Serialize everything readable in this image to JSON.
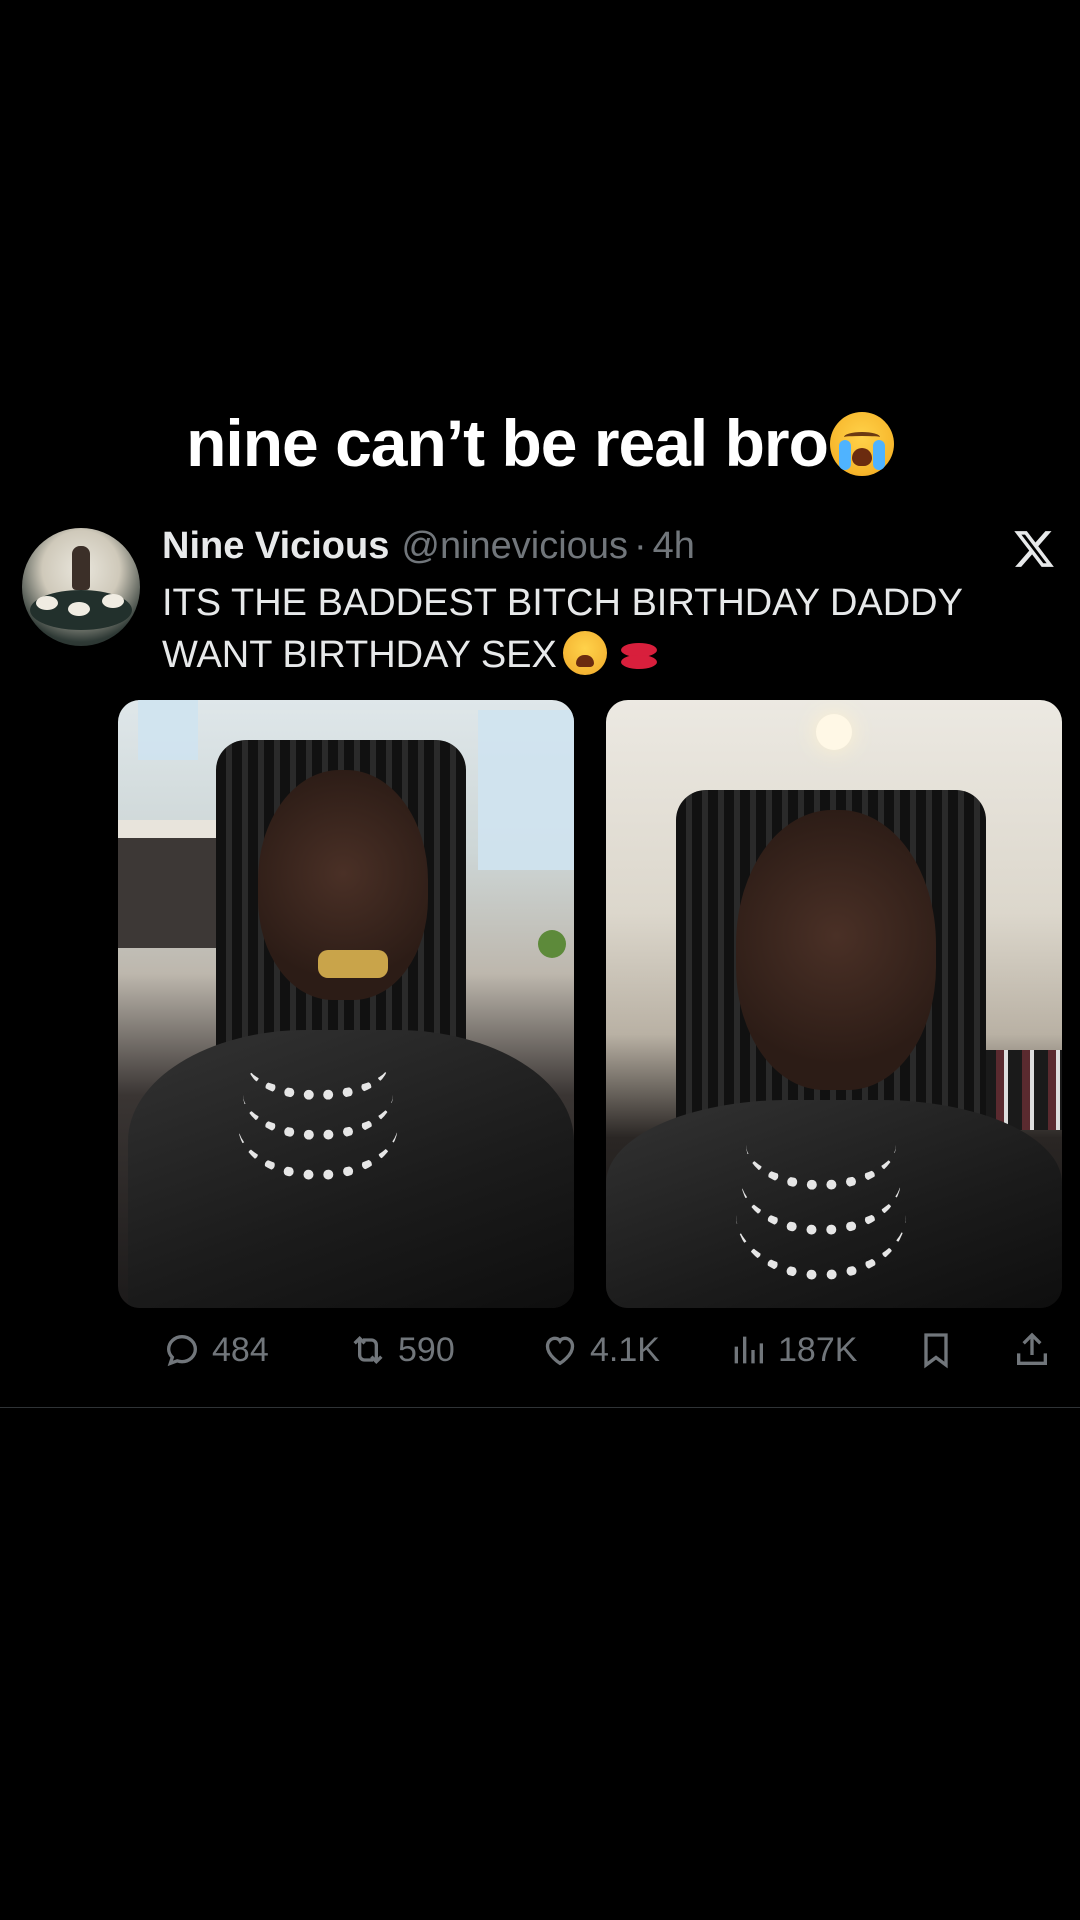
{
  "caption": {
    "text": "nine can’t be real bro",
    "emoji": "loudly-crying-face-icon"
  },
  "tweet": {
    "author_name": "Nine Vicious",
    "handle": "@ninevicious",
    "separator": "·",
    "time": "4h",
    "platform_icon": "x-logo-icon",
    "text_line1": "ITS THE BADDEST BITCH BIRTHDAY DADDY",
    "text_line2": "WANT BIRTHDAY SEX",
    "emojis": [
      "weary-face-icon",
      "kiss-mark-icon"
    ],
    "media_count": 2,
    "stats": {
      "replies": "484",
      "retweets": "590",
      "likes": "4.1K",
      "views": "187K"
    }
  },
  "colors": {
    "background": "#000000",
    "text_primary": "#e7e9ea",
    "text_secondary": "#71767b",
    "divider": "#2f3336"
  }
}
